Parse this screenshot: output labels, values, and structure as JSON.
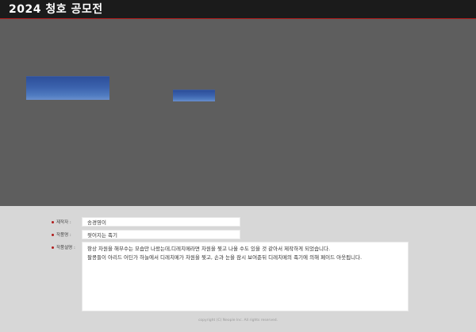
{
  "header": {
    "title": "2024 청호 공모전"
  },
  "form": {
    "author_label": "제작자 :",
    "author_value": "송경영이",
    "title_label": "작품명 :",
    "title_value": "젖어지는 족기",
    "desc_label": "작품설명 :",
    "desc_line1": "항상 차원을 해부수는 모습만 나왔는데,디레치메라면 차원을 찢고 나올 수도 있을 것 같아서 제작하게 되었습니다.",
    "desc_line2": "팔콩들이 아리드 어딘가 하늘에서 디레치메가 차원을 찢고, 손과 눈을 잠시 보여준뒤 디레치메의 족기에 의해 페이드 아웃됩니다."
  },
  "footer": {
    "copyright": "copyright (C) Neople Inc. All rights reserved."
  }
}
